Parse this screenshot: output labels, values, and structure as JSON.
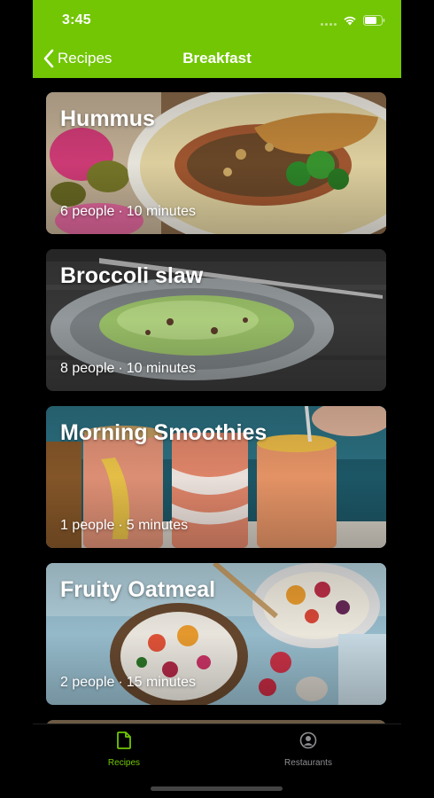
{
  "status_bar": {
    "time": "3:45"
  },
  "nav": {
    "back_label": "Recipes",
    "title": "Breakfast"
  },
  "recipes": [
    {
      "title": "Hummus",
      "people": "6 people",
      "time": "10 minutes"
    },
    {
      "title": "Broccoli slaw",
      "people": "8 people",
      "time": "10 minutes"
    },
    {
      "title": "Morning Smoothies",
      "people": "1 people",
      "time": "5 minutes"
    },
    {
      "title": "Fruity Oatmeal",
      "people": "2 people",
      "time": "15 minutes"
    }
  ],
  "separator": "·",
  "tabs": [
    {
      "label": "Recipes",
      "icon": "document-icon",
      "active": true
    },
    {
      "label": "Restaurants",
      "icon": "person-circle-icon",
      "active": false
    }
  ],
  "colors": {
    "accent": "#72c604",
    "inactive_tab": "#8e8e93",
    "background": "#000000"
  }
}
